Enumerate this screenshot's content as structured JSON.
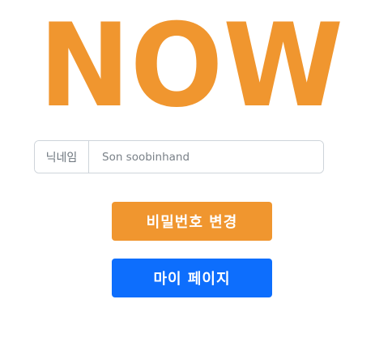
{
  "logo": {
    "text": "NOW",
    "color": "#f0962f"
  },
  "nickname": {
    "label": "닉네임",
    "value": "",
    "placeholder": "Son soobinhand"
  },
  "buttons": {
    "change_password": "비밀번호 변경",
    "my_page": "마이 페이지"
  },
  "colors": {
    "orange": "#f0962f",
    "blue": "#0d6efd",
    "border": "#ced4da"
  }
}
